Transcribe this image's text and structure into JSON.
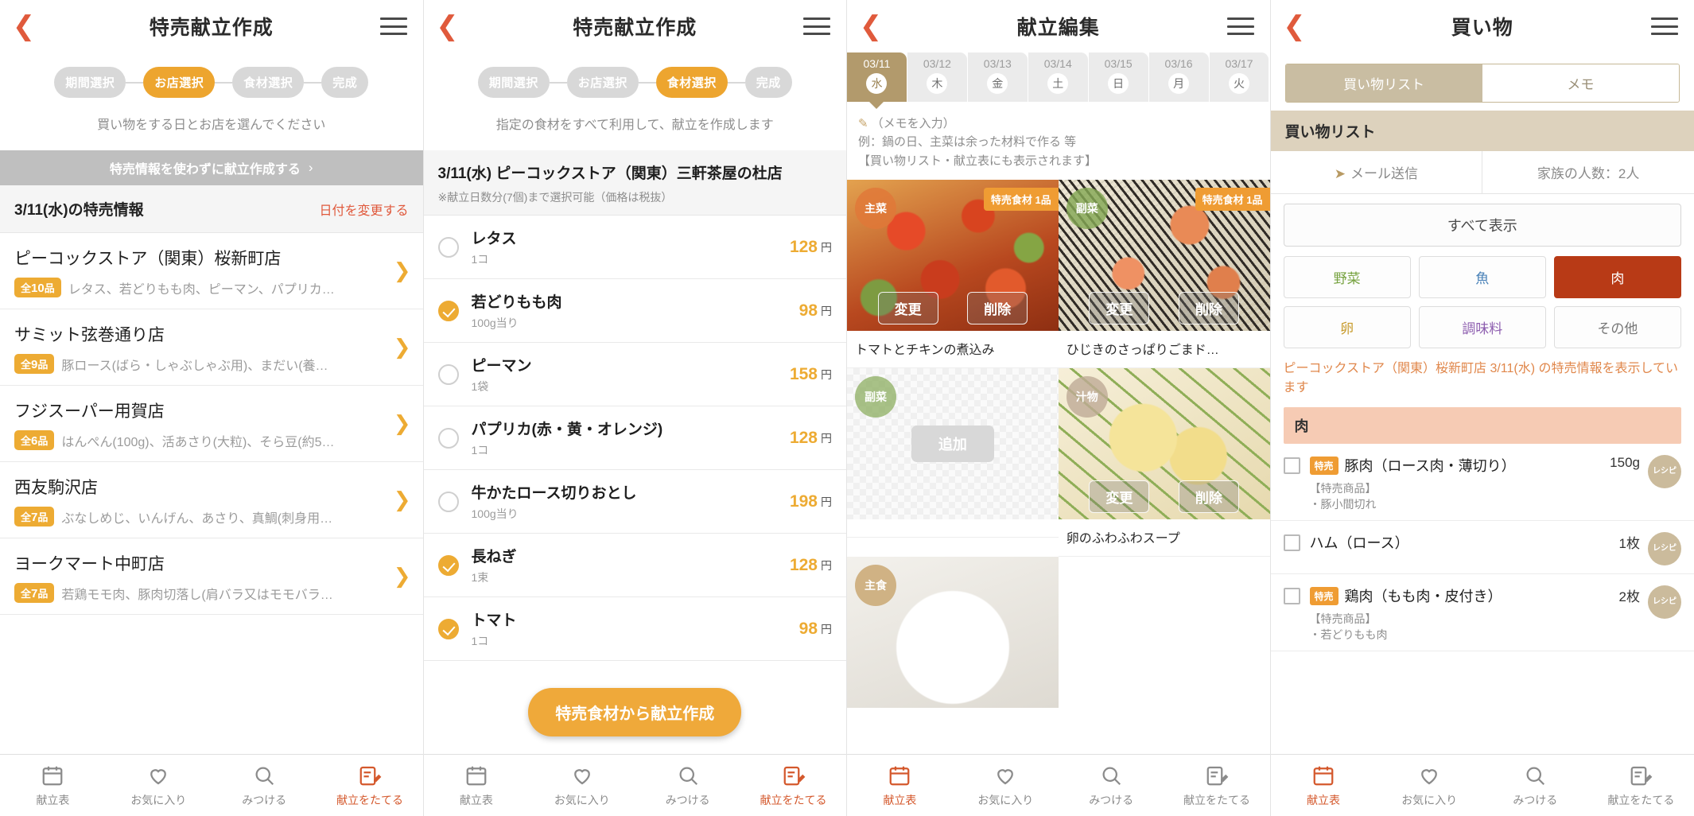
{
  "screens": [
    {
      "header": {
        "title": "特売献立作成",
        "back_icon": "chevron-left-icon",
        "menu_icon": "hamburger-icon"
      },
      "stepper": {
        "steps": [
          "期間選択",
          "お店選択",
          "食材選択",
          "完成"
        ],
        "active_index": 1
      },
      "note": "買い物をする日とお店を選んでください",
      "grey_bar": {
        "label": "特売情報を使わずに献立作成する",
        "chevron": "›"
      },
      "section": {
        "title": "3/11(水)の特売情報",
        "action": "日付を変更する"
      },
      "stores": [
        {
          "name": "ピーコックストア（関東）桜新町店",
          "badge_prefix": "全",
          "badge_count": "10",
          "badge_suffix": "品",
          "desc": "レタス、若どりもも肉、ピーマン、パプリカ…"
        },
        {
          "name": "サミット弦巻通り店",
          "badge_prefix": "全",
          "badge_count": "9",
          "badge_suffix": "品",
          "desc": "豚ロース(ばら・しゃぶしゃぶ用)、まだい(養…"
        },
        {
          "name": "フジスーパー用賀店",
          "badge_prefix": "全",
          "badge_count": "6",
          "badge_suffix": "品",
          "desc": "はんぺん(100g)、活あさり(大粒)、そら豆(約5…"
        },
        {
          "name": "西友駒沢店",
          "badge_prefix": "全",
          "badge_count": "7",
          "badge_suffix": "品",
          "desc": "ぶなしめじ、いんげん、あさり、真鯛(刺身用…"
        },
        {
          "name": "ヨークマート中町店",
          "badge_prefix": "全",
          "badge_count": "7",
          "badge_suffix": "品",
          "desc": "若鶏モモ肉、豚肉切落し(肩バラ又はモモバラ…"
        }
      ]
    },
    {
      "header": {
        "title": "特売献立作成",
        "back_icon": "chevron-left-icon",
        "menu_icon": "hamburger-icon"
      },
      "stepper": {
        "steps": [
          "期間選択",
          "お店選択",
          "食材選択",
          "完成"
        ],
        "active_index": 2
      },
      "note": "指定の食材をすべて利用して、献立を作成します",
      "ing_head": {
        "title": "3/11(水) ピーコックストア（関東）三軒茶屋の杜店",
        "note": "※献立日数分(7個)まで選択可能（価格は税抜）"
      },
      "ingredients": [
        {
          "name": "レタス",
          "unit": "1コ",
          "price": "128",
          "yen": "円",
          "checked": false
        },
        {
          "name": "若どりもも肉",
          "unit": "100g当り",
          "price": "98",
          "yen": "円",
          "checked": true
        },
        {
          "name": "ピーマン",
          "unit": "1袋",
          "price": "158",
          "yen": "円",
          "checked": false
        },
        {
          "name": "パプリカ(赤・黄・オレンジ)",
          "unit": "1コ",
          "price": "128",
          "yen": "円",
          "checked": false
        },
        {
          "name": "牛かたロース切りおとし",
          "unit": "100g当り",
          "price": "198",
          "yen": "円",
          "checked": false
        },
        {
          "name": "長ねぎ",
          "unit": "1束",
          "price": "128",
          "yen": "円",
          "checked": true
        },
        {
          "name": "トマト",
          "unit": "1コ",
          "price": "98",
          "yen": "円",
          "checked": true
        }
      ],
      "fab_label": "特売食材から献立作成"
    },
    {
      "header": {
        "title": "献立編集",
        "back_icon": "chevron-left-icon",
        "menu_icon": "hamburger-icon"
      },
      "dates": [
        {
          "date": "03/11",
          "weekday": "水",
          "selected": true
        },
        {
          "date": "03/12",
          "weekday": "木",
          "selected": false
        },
        {
          "date": "03/13",
          "weekday": "金",
          "selected": false
        },
        {
          "date": "03/14",
          "weekday": "土",
          "selected": false
        },
        {
          "date": "03/15",
          "weekday": "日",
          "selected": false
        },
        {
          "date": "03/16",
          "weekday": "月",
          "selected": false
        },
        {
          "date": "03/17",
          "weekday": "火",
          "selected": false
        }
      ],
      "memo": {
        "pen_icon": "pencil-icon",
        "line1": "（メモを入力）",
        "line2": "例：鍋の日、主菜は余った材料で作る 等",
        "line3": "【買い物リスト・献立表にも表示されます】"
      },
      "dishes": [
        {
          "tag": "主菜",
          "tag_class": "shusai",
          "sale_badge": "特売食材 1品",
          "caption": "トマトとチキンの煮込み",
          "photo": "ph-tomato",
          "btn_change": "変更",
          "btn_delete": "削除",
          "empty": false
        },
        {
          "tag": "副菜",
          "tag_class": "fukusai",
          "sale_badge": "特売食材 1品",
          "caption": "ひじきのさっぱりごまド…",
          "photo": "ph-hijiki",
          "btn_change": "変更",
          "btn_delete": "削除",
          "empty": false
        },
        {
          "tag": "副菜",
          "tag_class": "fukusai",
          "sale_badge": "",
          "caption": "",
          "photo": "",
          "add_label": "追加",
          "empty": true
        },
        {
          "tag": "汁物",
          "tag_class": "shirumono",
          "sale_badge": "",
          "caption": "卵のふわふわスープ",
          "photo": "ph-soup",
          "btn_change": "変更",
          "btn_delete": "削除",
          "empty": false
        },
        {
          "tag": "主食",
          "tag_class": "shushoku",
          "sale_badge": "",
          "caption": "",
          "photo": "ph-rice",
          "btn_change": "変更",
          "btn_delete": "削除",
          "empty": false
        }
      ]
    },
    {
      "header": {
        "title": "買い物",
        "back_icon": "chevron-left-icon",
        "menu_icon": "hamburger-icon"
      },
      "segments": [
        {
          "label": "買い物リスト",
          "on": true
        },
        {
          "label": "メモ",
          "on": false
        }
      ],
      "list_title": "買い物リスト",
      "actions": {
        "mail": "メール送信",
        "mail_icon": "send-icon",
        "family": "家族の人数：2人"
      },
      "show_all": "すべて表示",
      "categories": [
        {
          "label": "野菜",
          "cls": "veg"
        },
        {
          "label": "魚",
          "cls": "fish"
        },
        {
          "label": "肉",
          "cls": "meat"
        },
        {
          "label": "卵",
          "cls": "egg"
        },
        {
          "label": "調味料",
          "cls": "season"
        },
        {
          "label": "その他",
          "cls": "other"
        }
      ],
      "sale_note": "ピーコックストア（関東）桜新町店 3/11(水) の特売情報を表示しています",
      "group_title": "肉",
      "items": [
        {
          "tokubai": "特売",
          "name": "豚肉（ロース肉・薄切り）",
          "qty": "150g",
          "sub": "【特売商品】\n・豚小間切れ",
          "recipe": "レシピ"
        },
        {
          "tokubai": "",
          "name": "ハム（ロース）",
          "qty": "1枚",
          "sub": "",
          "recipe": "レシピ"
        },
        {
          "tokubai": "特売",
          "name": "鶏肉（もも肉・皮付き）",
          "qty": "2枚",
          "sub": "【特売商品】\n・若どりもも肉",
          "recipe": "レシピ"
        }
      ]
    }
  ],
  "nav": {
    "items": [
      {
        "label": "献立表",
        "icon": "calendar-icon",
        "active_on": [
          2
        ]
      },
      {
        "label": "お気に入り",
        "icon": "heart-icon",
        "active_on": []
      },
      {
        "label": "みつける",
        "icon": "search-icon",
        "active_on": []
      },
      {
        "label": "献立をたてる",
        "icon": "menu-plan-icon",
        "active_on": [
          0,
          1
        ]
      }
    ],
    "nav4_active_index": 0
  },
  "colors": {
    "accent_orange": "#edab33",
    "back_red": "#e05a3c",
    "nav_active": "#d4582c",
    "beige": "#b29a6c",
    "meat_red": "#b83a16"
  }
}
